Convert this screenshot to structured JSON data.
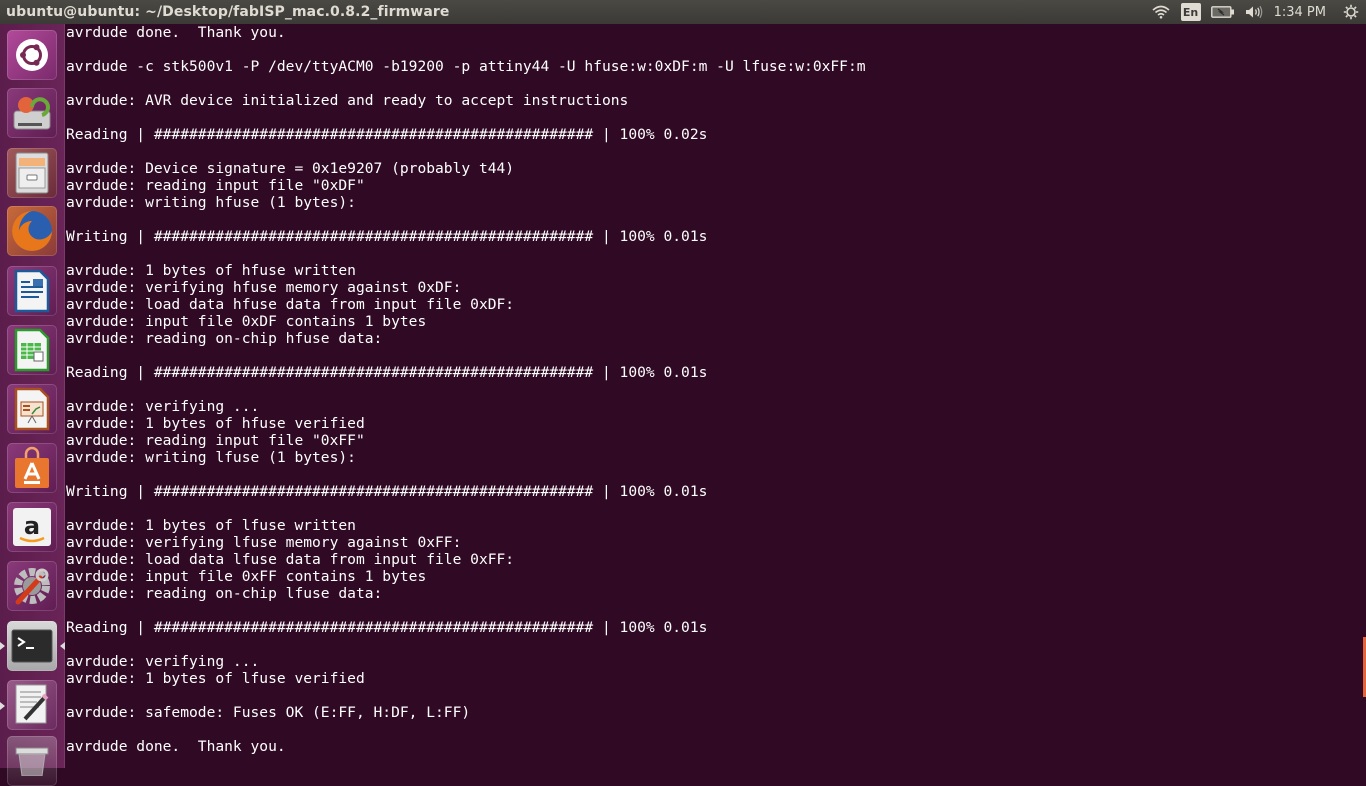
{
  "window": {
    "title": "ubuntu@ubuntu: ~/Desktop/fabISP_mac.0.8.2_firmware"
  },
  "indicators": {
    "keyboard_layout": "En",
    "clock": "1:34 PM",
    "icons": [
      "wifi-icon",
      "keyboard-layout-icon",
      "battery-icon",
      "volume-icon",
      "power-gear-icon"
    ]
  },
  "launcher": {
    "items": [
      {
        "name": "dash-home",
        "label": "Search your computer",
        "running": false
      },
      {
        "name": "software-updater",
        "label": "Software Updater",
        "running": false
      },
      {
        "name": "files",
        "label": "Files",
        "running": true
      },
      {
        "name": "firefox",
        "label": "Firefox Web Browser",
        "running": true
      },
      {
        "name": "libreoffice-writer",
        "label": "LibreOffice Writer",
        "running": false
      },
      {
        "name": "libreoffice-calc",
        "label": "LibreOffice Calc",
        "running": false
      },
      {
        "name": "libreoffice-impress",
        "label": "LibreOffice Impress",
        "running": false
      },
      {
        "name": "ubuntu-software-center",
        "label": "Ubuntu Software Center",
        "running": false
      },
      {
        "name": "amazon",
        "label": "Amazon",
        "running": false
      },
      {
        "name": "system-settings",
        "label": "System Settings",
        "running": false
      },
      {
        "name": "terminal",
        "label": "Terminal",
        "running": true,
        "focused": true
      },
      {
        "name": "text-editor",
        "label": "Text Editor",
        "running": true
      },
      {
        "name": "trash",
        "label": "Trash",
        "running": false
      }
    ]
  },
  "terminal": {
    "colors": {
      "background": "#300a24",
      "foreground": "#ffffff",
      "scrollbar": "#e3643a"
    },
    "lines": [
      "avrdude done.  Thank you.",
      "",
      "avrdude -c stk500v1 -P /dev/ttyACM0 -b19200 -p attiny44 -U hfuse:w:0xDF:m -U lfuse:w:0xFF:m",
      "",
      "avrdude: AVR device initialized and ready to accept instructions",
      "",
      "Reading | ################################################## | 100% 0.02s",
      "",
      "avrdude: Device signature = 0x1e9207 (probably t44)",
      "avrdude: reading input file \"0xDF\"",
      "avrdude: writing hfuse (1 bytes):",
      "",
      "Writing | ################################################## | 100% 0.01s",
      "",
      "avrdude: 1 bytes of hfuse written",
      "avrdude: verifying hfuse memory against 0xDF:",
      "avrdude: load data hfuse data from input file 0xDF:",
      "avrdude: input file 0xDF contains 1 bytes",
      "avrdude: reading on-chip hfuse data:",
      "",
      "Reading | ################################################## | 100% 0.01s",
      "",
      "avrdude: verifying ...",
      "avrdude: 1 bytes of hfuse verified",
      "avrdude: reading input file \"0xFF\"",
      "avrdude: writing lfuse (1 bytes):",
      "",
      "Writing | ################################################## | 100% 0.01s",
      "",
      "avrdude: 1 bytes of lfuse written",
      "avrdude: verifying lfuse memory against 0xFF:",
      "avrdude: load data lfuse data from input file 0xFF:",
      "avrdude: input file 0xFF contains 1 bytes",
      "avrdude: reading on-chip lfuse data:",
      "",
      "Reading | ################################################## | 100% 0.01s",
      "",
      "avrdude: verifying ...",
      "avrdude: 1 bytes of lfuse verified",
      "",
      "avrdude: safemode: Fuses OK (E:FF, H:DF, L:FF)",
      "",
      "avrdude done.  Thank you.",
      ""
    ]
  }
}
